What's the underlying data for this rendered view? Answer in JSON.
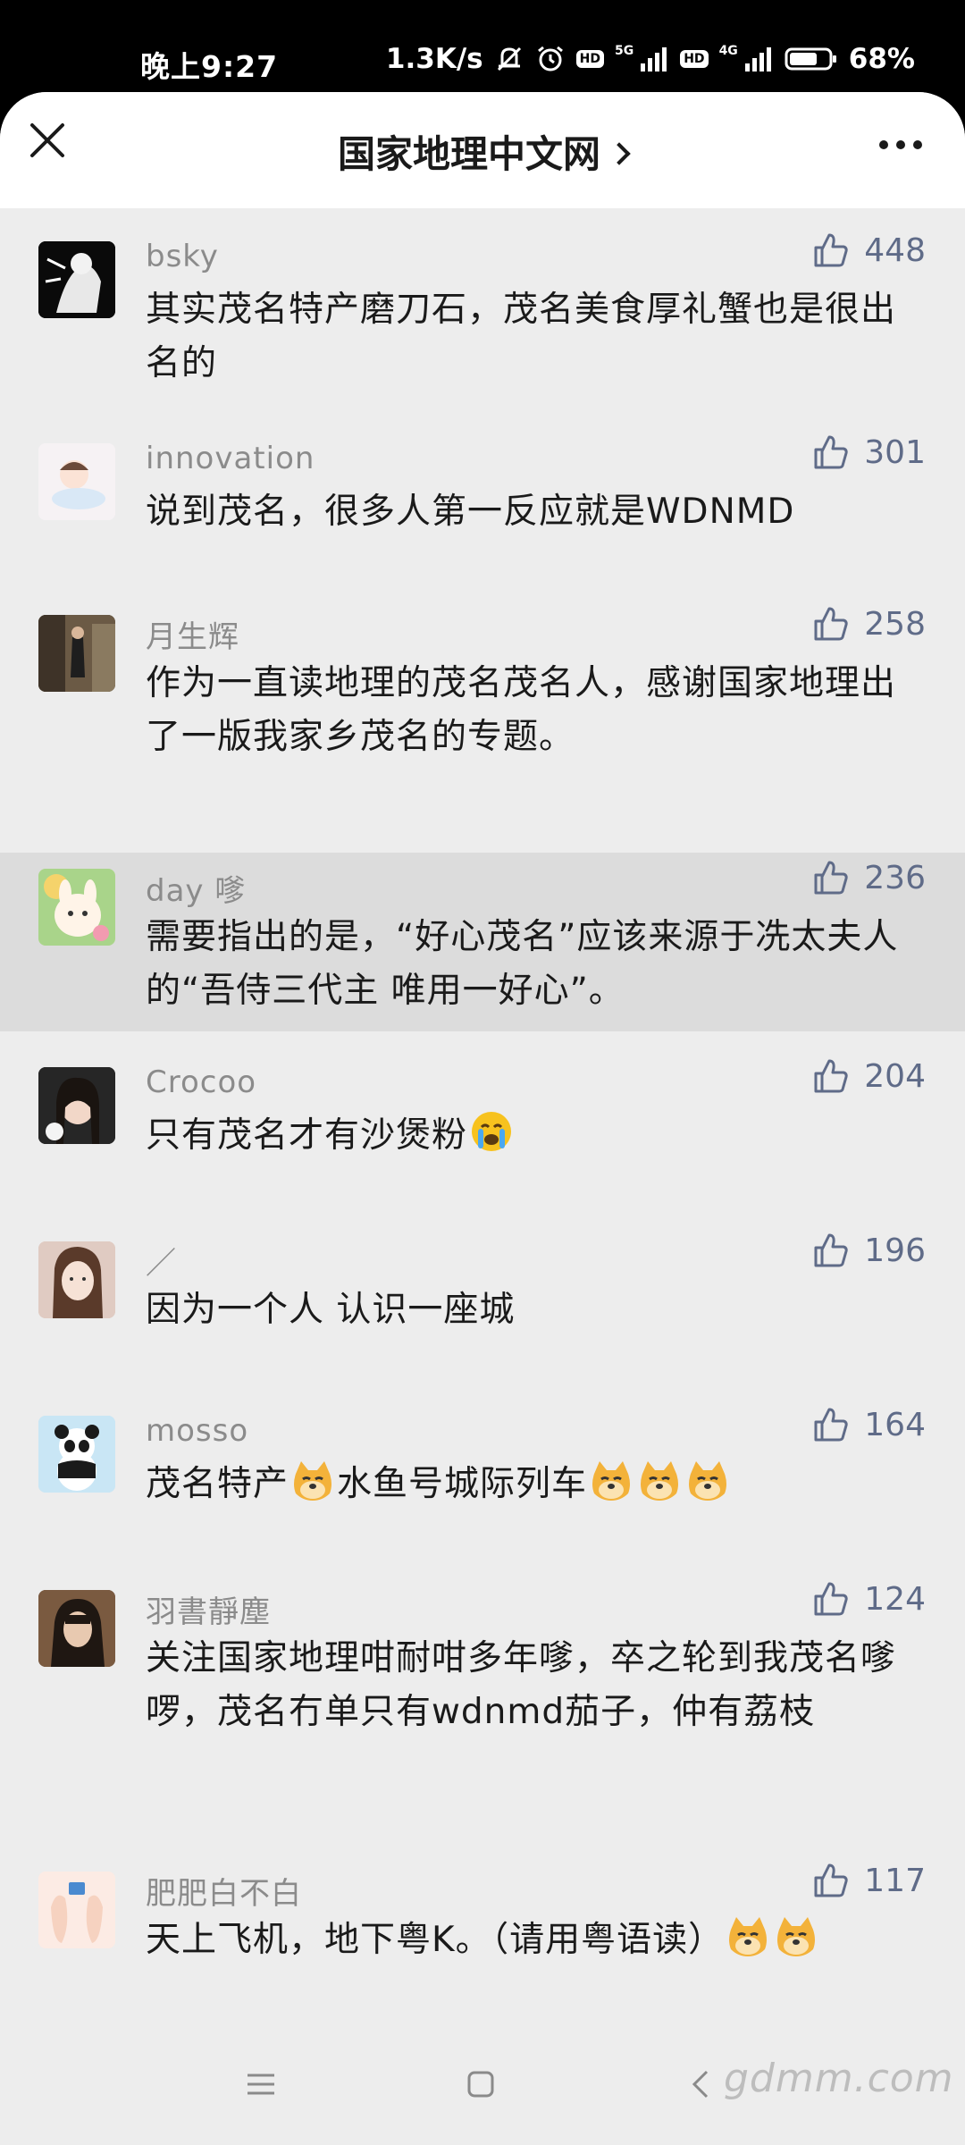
{
  "status_bar": {
    "time": "晚上9:27",
    "net_speed": "1.3K/s",
    "net_tag_1": "5G",
    "net_tag_2": "4G",
    "hd_1": "HD",
    "hd_2": "HD",
    "battery": "68%"
  },
  "header": {
    "title": "国家地理中文网"
  },
  "comments": [
    {
      "name": "bsky",
      "likes": "448",
      "text": "其实茂名特产磨刀石，茂名美食厚礼蟹也是很出名的"
    },
    {
      "name": "innovation",
      "likes": "301",
      "text": "说到茂名，很多人第一反应就是WDNMD"
    },
    {
      "name": "月生辉",
      "likes": "258",
      "text": "作为一直读地理的茂名茂名人，感谢国家地理出了一版我家乡茂名的专题。"
    },
    {
      "name": "day 嗲",
      "likes": "236",
      "text": "需要指出的是，“好心茂名”应该来源于冼太夫人的“吾侍三代主 唯用一好心”。"
    },
    {
      "name": "Crocoo",
      "likes": "204",
      "text": "只有茂名才有沙煲粉"
    },
    {
      "name": "／",
      "likes": "196",
      "text": "因为一个人 认识一座城"
    },
    {
      "name": "mosso",
      "likes": "164",
      "text_a": "茂名特产",
      "text_b": "水鱼号城际列车"
    },
    {
      "name": "羽書靜塵",
      "likes": "124",
      "text": "关注国家地理咁耐咁多年嗲，卒之轮到我茂名嗲啰，茂名冇单只有wdnmd茄子，仲有荔枝"
    },
    {
      "name": "肥肥白不白",
      "likes": "117",
      "text": "天上飞机，地下粤K。（请用粤语读）"
    }
  ],
  "watermark": "gdmm.com",
  "colors": {
    "background": "#ededed",
    "highlight_row": "#dcdcdc",
    "like_color": "#5f6b88",
    "name_color": "#8b8b8b"
  }
}
